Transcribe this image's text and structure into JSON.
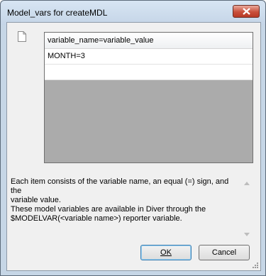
{
  "window": {
    "title": "Model_vars for createMDL"
  },
  "grid": {
    "header": "variable_name=variable_value",
    "rows": [
      "MONTH=3",
      ""
    ]
  },
  "description": {
    "line1": "Each item consists of the variable name, an equal (=) sign, and the",
    "line2": "variable value.",
    "line3": "These model variables are available in Diver through the",
    "line4": "$MODELVAR(<variable name>) reporter variable."
  },
  "buttons": {
    "ok_label": "OK",
    "cancel_label": "Cancel"
  },
  "icons": {
    "close": "close-icon",
    "document": "document-icon",
    "scroll_up": "scroll-up-arrow-icon",
    "scroll_down": "scroll-down-arrow-icon",
    "resize_grip": "resize-grip-icon"
  },
  "colors": {
    "window_frame": "#c6d6e6",
    "client_bg": "#f0f0f0",
    "grid_empty_bg": "#ababab",
    "close_button": "#c94f3b",
    "default_button_border": "#3c7fb1"
  }
}
